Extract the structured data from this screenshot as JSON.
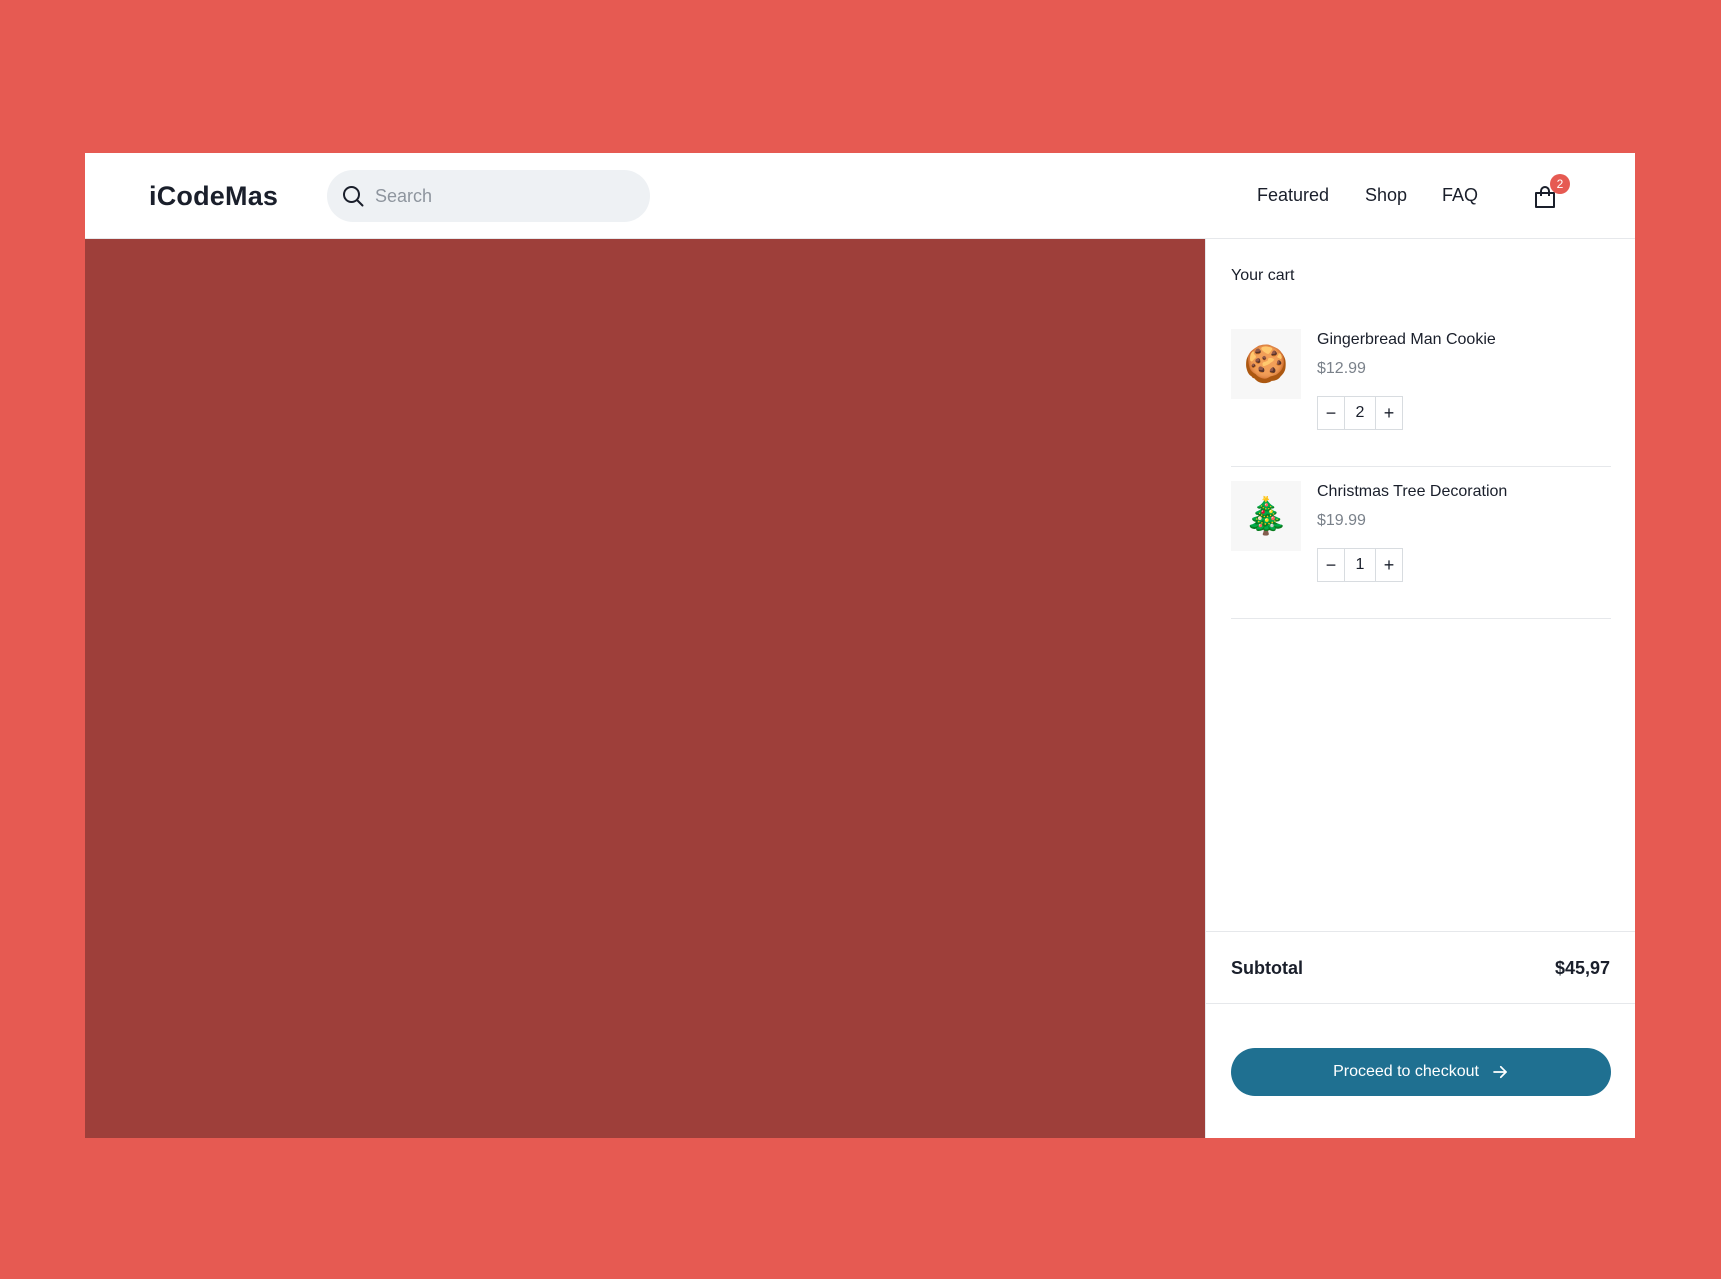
{
  "app": {
    "logo": "iCodeMas"
  },
  "search": {
    "placeholder": "Search",
    "icon": "search-icon"
  },
  "nav": {
    "featured": "Featured",
    "shop": "Shop",
    "faq": "FAQ"
  },
  "cart_button": {
    "icon": "shopping-bag-icon",
    "badge_count": "2"
  },
  "cart": {
    "title": "Your cart",
    "items": [
      {
        "name": "Gingerbread Man Cookie",
        "price": "$12.99",
        "quantity": "2",
        "thumbnail_icon": "gingerbread-man-icon",
        "thumbnail_glyph": "🍪"
      },
      {
        "name": "Christmas Tree Decoration",
        "price": "$19.99",
        "quantity": "1",
        "thumbnail_icon": "christmas-tree-icon",
        "thumbnail_glyph": "🎄"
      }
    ],
    "decrement_label": "−",
    "increment_label": "+",
    "subtotal_label": "Subtotal",
    "subtotal_value": "$45,97",
    "checkout_label": "Proceed to checkout"
  },
  "colors": {
    "page_background": "#E65A52",
    "hero_background": "#9E3F3A",
    "checkout_button": "#1F7091",
    "badge": "#E65A52"
  }
}
